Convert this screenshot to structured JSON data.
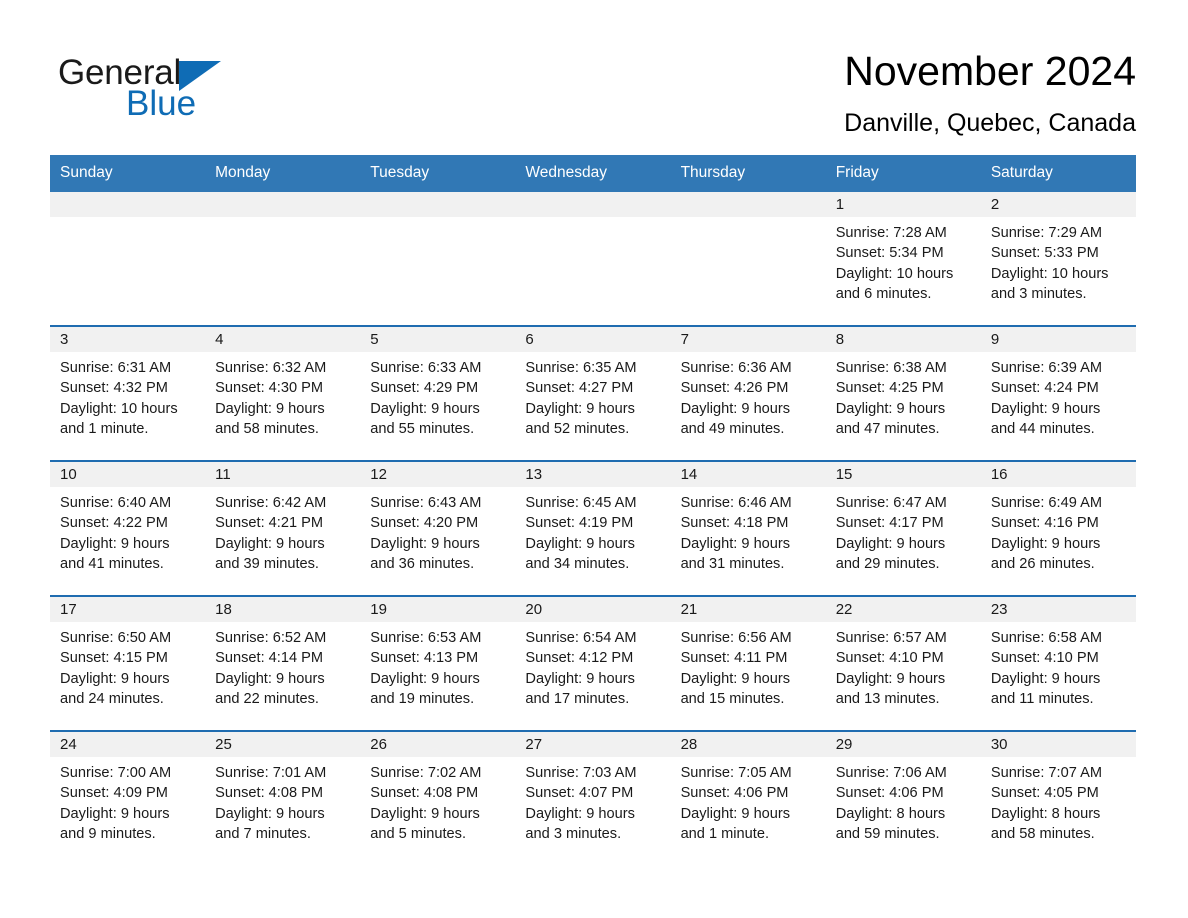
{
  "brand": {
    "name_part1": "General",
    "name_part2": "Blue",
    "mark": "triangle-logo"
  },
  "header": {
    "month_title": "November 2024",
    "location": "Danville, Quebec, Canada"
  },
  "colors": {
    "header_blue": "#3178b5",
    "row_divider_blue": "#1f6cb0",
    "day_band_gray": "#f1f1f1",
    "brand_blue": "#0f6cb5"
  },
  "weekdays": [
    "Sunday",
    "Monday",
    "Tuesday",
    "Wednesday",
    "Thursday",
    "Friday",
    "Saturday"
  ],
  "weeks": [
    [
      {
        "day": "",
        "empty": true,
        "sunrise": "",
        "sunset": "",
        "daylight1": "",
        "daylight2": ""
      },
      {
        "day": "",
        "empty": true,
        "sunrise": "",
        "sunset": "",
        "daylight1": "",
        "daylight2": ""
      },
      {
        "day": "",
        "empty": true,
        "sunrise": "",
        "sunset": "",
        "daylight1": "",
        "daylight2": ""
      },
      {
        "day": "",
        "empty": true,
        "sunrise": "",
        "sunset": "",
        "daylight1": "",
        "daylight2": ""
      },
      {
        "day": "",
        "empty": true,
        "sunrise": "",
        "sunset": "",
        "daylight1": "",
        "daylight2": ""
      },
      {
        "day": "1",
        "sunrise": "Sunrise: 7:28 AM",
        "sunset": "Sunset: 5:34 PM",
        "daylight1": "Daylight: 10 hours",
        "daylight2": "and 6 minutes."
      },
      {
        "day": "2",
        "sunrise": "Sunrise: 7:29 AM",
        "sunset": "Sunset: 5:33 PM",
        "daylight1": "Daylight: 10 hours",
        "daylight2": "and 3 minutes."
      }
    ],
    [
      {
        "day": "3",
        "sunrise": "Sunrise: 6:31 AM",
        "sunset": "Sunset: 4:32 PM",
        "daylight1": "Daylight: 10 hours",
        "daylight2": "and 1 minute."
      },
      {
        "day": "4",
        "sunrise": "Sunrise: 6:32 AM",
        "sunset": "Sunset: 4:30 PM",
        "daylight1": "Daylight: 9 hours",
        "daylight2": "and 58 minutes."
      },
      {
        "day": "5",
        "sunrise": "Sunrise: 6:33 AM",
        "sunset": "Sunset: 4:29 PM",
        "daylight1": "Daylight: 9 hours",
        "daylight2": "and 55 minutes."
      },
      {
        "day": "6",
        "sunrise": "Sunrise: 6:35 AM",
        "sunset": "Sunset: 4:27 PM",
        "daylight1": "Daylight: 9 hours",
        "daylight2": "and 52 minutes."
      },
      {
        "day": "7",
        "sunrise": "Sunrise: 6:36 AM",
        "sunset": "Sunset: 4:26 PM",
        "daylight1": "Daylight: 9 hours",
        "daylight2": "and 49 minutes."
      },
      {
        "day": "8",
        "sunrise": "Sunrise: 6:38 AM",
        "sunset": "Sunset: 4:25 PM",
        "daylight1": "Daylight: 9 hours",
        "daylight2": "and 47 minutes."
      },
      {
        "day": "9",
        "sunrise": "Sunrise: 6:39 AM",
        "sunset": "Sunset: 4:24 PM",
        "daylight1": "Daylight: 9 hours",
        "daylight2": "and 44 minutes."
      }
    ],
    [
      {
        "day": "10",
        "sunrise": "Sunrise: 6:40 AM",
        "sunset": "Sunset: 4:22 PM",
        "daylight1": "Daylight: 9 hours",
        "daylight2": "and 41 minutes."
      },
      {
        "day": "11",
        "sunrise": "Sunrise: 6:42 AM",
        "sunset": "Sunset: 4:21 PM",
        "daylight1": "Daylight: 9 hours",
        "daylight2": "and 39 minutes."
      },
      {
        "day": "12",
        "sunrise": "Sunrise: 6:43 AM",
        "sunset": "Sunset: 4:20 PM",
        "daylight1": "Daylight: 9 hours",
        "daylight2": "and 36 minutes."
      },
      {
        "day": "13",
        "sunrise": "Sunrise: 6:45 AM",
        "sunset": "Sunset: 4:19 PM",
        "daylight1": "Daylight: 9 hours",
        "daylight2": "and 34 minutes."
      },
      {
        "day": "14",
        "sunrise": "Sunrise: 6:46 AM",
        "sunset": "Sunset: 4:18 PM",
        "daylight1": "Daylight: 9 hours",
        "daylight2": "and 31 minutes."
      },
      {
        "day": "15",
        "sunrise": "Sunrise: 6:47 AM",
        "sunset": "Sunset: 4:17 PM",
        "daylight1": "Daylight: 9 hours",
        "daylight2": "and 29 minutes."
      },
      {
        "day": "16",
        "sunrise": "Sunrise: 6:49 AM",
        "sunset": "Sunset: 4:16 PM",
        "daylight1": "Daylight: 9 hours",
        "daylight2": "and 26 minutes."
      }
    ],
    [
      {
        "day": "17",
        "sunrise": "Sunrise: 6:50 AM",
        "sunset": "Sunset: 4:15 PM",
        "daylight1": "Daylight: 9 hours",
        "daylight2": "and 24 minutes."
      },
      {
        "day": "18",
        "sunrise": "Sunrise: 6:52 AM",
        "sunset": "Sunset: 4:14 PM",
        "daylight1": "Daylight: 9 hours",
        "daylight2": "and 22 minutes."
      },
      {
        "day": "19",
        "sunrise": "Sunrise: 6:53 AM",
        "sunset": "Sunset: 4:13 PM",
        "daylight1": "Daylight: 9 hours",
        "daylight2": "and 19 minutes."
      },
      {
        "day": "20",
        "sunrise": "Sunrise: 6:54 AM",
        "sunset": "Sunset: 4:12 PM",
        "daylight1": "Daylight: 9 hours",
        "daylight2": "and 17 minutes."
      },
      {
        "day": "21",
        "sunrise": "Sunrise: 6:56 AM",
        "sunset": "Sunset: 4:11 PM",
        "daylight1": "Daylight: 9 hours",
        "daylight2": "and 15 minutes."
      },
      {
        "day": "22",
        "sunrise": "Sunrise: 6:57 AM",
        "sunset": "Sunset: 4:10 PM",
        "daylight1": "Daylight: 9 hours",
        "daylight2": "and 13 minutes."
      },
      {
        "day": "23",
        "sunrise": "Sunrise: 6:58 AM",
        "sunset": "Sunset: 4:10 PM",
        "daylight1": "Daylight: 9 hours",
        "daylight2": "and 11 minutes."
      }
    ],
    [
      {
        "day": "24",
        "sunrise": "Sunrise: 7:00 AM",
        "sunset": "Sunset: 4:09 PM",
        "daylight1": "Daylight: 9 hours",
        "daylight2": "and 9 minutes."
      },
      {
        "day": "25",
        "sunrise": "Sunrise: 7:01 AM",
        "sunset": "Sunset: 4:08 PM",
        "daylight1": "Daylight: 9 hours",
        "daylight2": "and 7 minutes."
      },
      {
        "day": "26",
        "sunrise": "Sunrise: 7:02 AM",
        "sunset": "Sunset: 4:08 PM",
        "daylight1": "Daylight: 9 hours",
        "daylight2": "and 5 minutes."
      },
      {
        "day": "27",
        "sunrise": "Sunrise: 7:03 AM",
        "sunset": "Sunset: 4:07 PM",
        "daylight1": "Daylight: 9 hours",
        "daylight2": "and 3 minutes."
      },
      {
        "day": "28",
        "sunrise": "Sunrise: 7:05 AM",
        "sunset": "Sunset: 4:06 PM",
        "daylight1": "Daylight: 9 hours",
        "daylight2": "and 1 minute."
      },
      {
        "day": "29",
        "sunrise": "Sunrise: 7:06 AM",
        "sunset": "Sunset: 4:06 PM",
        "daylight1": "Daylight: 8 hours",
        "daylight2": "and 59 minutes."
      },
      {
        "day": "30",
        "sunrise": "Sunrise: 7:07 AM",
        "sunset": "Sunset: 4:05 PM",
        "daylight1": "Daylight: 8 hours",
        "daylight2": "and 58 minutes."
      }
    ]
  ]
}
